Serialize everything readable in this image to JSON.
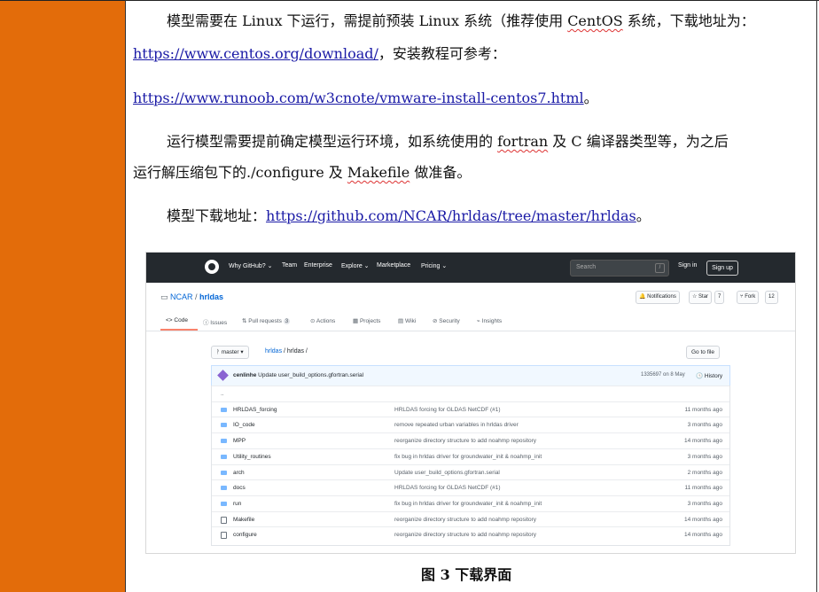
{
  "document": {
    "p1_line1_a": "模型需要在 Linux 下运行，需提前预装 Linux 系统（推荐使用 ",
    "p1_line1_centos": "CentOS",
    "p1_line1_b": " 系统，下载地址为：",
    "p1_url1": "https://www.centos.org/download/",
    "p1_line2_suffix": "，安装教程可参考：",
    "p1_url2": "https://www.runoob.com/w3cnote/vmware-install-centos7.html",
    "p1_line3_suffix": "。",
    "p2_line1_a": "运行模型需要提前确定模型运行环境，如系统使用的 ",
    "p2_fortran": "fortran",
    "p2_line1_b": " 及 C 编译器类型等，为之后",
    "p2_line2_a": "运行解压缩包下的./configure 及 ",
    "p2_makefile": "Makefile",
    "p2_line2_b": " 做准备。",
    "p3_label": "模型下载地址：",
    "p3_url": "https://github.com/NCAR/hrldas/tree/master/hrldas",
    "p3_suffix": "。",
    "caption": "图 3  下载界面"
  },
  "github": {
    "nav": [
      "Why GitHub? ⌄",
      "Team",
      "Enterprise",
      "Explore ⌄",
      "Marketplace",
      "Pricing ⌄"
    ],
    "search_placeholder": "Search",
    "search_key": "/",
    "sign_in": "Sign in",
    "sign_up": "Sign up",
    "repo_owner": "NCAR",
    "repo_sep": " / ",
    "repo_name": "hrldas",
    "notifications": "🔔 Notifications",
    "star": "☆ Star",
    "star_count": "7",
    "fork": "⑂ Fork",
    "fork_count": "12",
    "tabs": [
      "<> Code",
      "ⓘ Issues",
      "⇅ Pull requests",
      "⊙ Actions",
      "▦ Projects",
      "▤ Wiki",
      "⊘ Security",
      "⌁ Insights"
    ],
    "pr_count": "3",
    "branch": "ᚹ master ▾",
    "path_repo": "hrldas",
    "path_rest": " / hrldas /",
    "go_to_file": "Go to file",
    "commit_author": "cenlinhe",
    "commit_msg": " Update user_build_options.gfortran.serial",
    "commit_hash": "1335697  on 8 May",
    "history": "🕓 History",
    "parent_dir": "..",
    "files": [
      {
        "name": "HRLDAS_forcing",
        "type": "dir",
        "commit": "HRLDAS forcing for GLDAS NetCDF (#1)",
        "time": "11 months ago"
      },
      {
        "name": "IO_code",
        "type": "dir",
        "commit": "remove repeated urban variables in hrldas driver",
        "time": "3 months ago"
      },
      {
        "name": "MPP",
        "type": "dir",
        "commit": "reorganize directory structure to add noahmp repository",
        "time": "14 months ago"
      },
      {
        "name": "Utility_routines",
        "type": "dir",
        "commit": "fix bug in hrldas driver for groundwater_init & noahmp_init",
        "time": "3 months ago"
      },
      {
        "name": "arch",
        "type": "dir",
        "commit": "Update user_build_options.gfortran.serial",
        "time": "2 months ago"
      },
      {
        "name": "docs",
        "type": "dir",
        "commit": "HRLDAS forcing for GLDAS NetCDF (#1)",
        "time": "11 months ago"
      },
      {
        "name": "run",
        "type": "dir",
        "commit": "fix bug in hrldas driver for groundwater_init & noahmp_init",
        "time": "3 months ago"
      },
      {
        "name": "Makefile",
        "type": "file",
        "commit": "reorganize directory structure to add noahmp repository",
        "time": "14 months ago"
      },
      {
        "name": "configure",
        "type": "file",
        "commit": "reorganize directory structure to add noahmp repository",
        "time": "14 months ago"
      }
    ]
  },
  "colors": {
    "sidebar": "#e36c0a",
    "link": "#1a1aa6",
    "gh_header": "#24292e"
  }
}
